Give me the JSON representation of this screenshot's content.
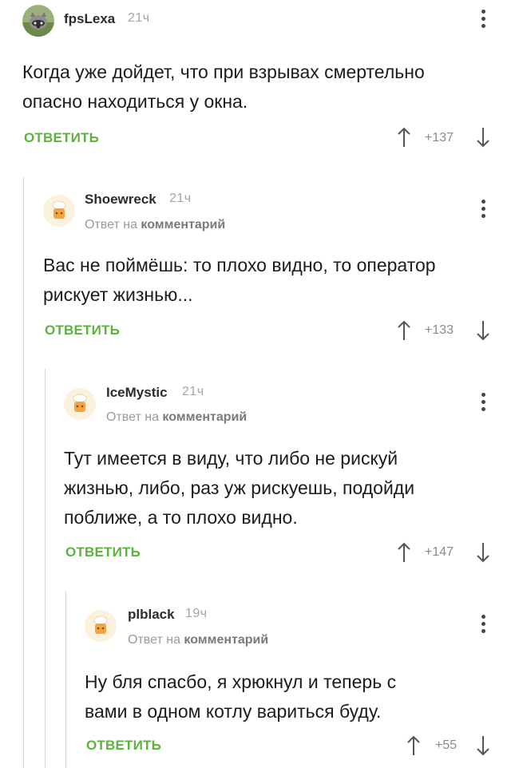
{
  "comments": [
    {
      "author": "fpsLexa",
      "time": "21ч",
      "reply_meta": "",
      "text_lines": [
        "Когда уже дойдет, что при взрывах смертельно",
        "опасно находиться у окна."
      ],
      "reply_label": "ОТВЕТИТЬ",
      "score": "+137",
      "avatar": "raccoon-avatar"
    },
    {
      "author": "Shoewreck",
      "time": "21ч",
      "reply_meta_prefix": "Ответ на",
      "reply_meta_link": "комментарий",
      "text_lines": [
        "Вас не поймёшь: то плохо видно, то оператор",
        "рискует жизнью..."
      ],
      "reply_label": "ОТВЕТИТЬ",
      "score": "+133",
      "avatar": "default-cook-avatar"
    },
    {
      "author": "IceMystic",
      "time": "21ч",
      "reply_meta_prefix": "Ответ на",
      "reply_meta_link": "комментарий",
      "text_lines": [
        "Тут имеется в виду, что либо не рискуй",
        "жизнью, либо, раз уж рискуешь, подойди",
        "поближе, а то плохо видно."
      ],
      "reply_label": "ОТВЕТИТЬ",
      "score": "+147",
      "avatar": "default-cook-avatar"
    },
    {
      "author": "plblack",
      "time": "19ч",
      "reply_meta_prefix": "Ответ на",
      "reply_meta_link": "комментарий",
      "text_lines": [
        "Ну бля спасбо, я хрюкнул и теперь с",
        "вами в одном котлу вариться буду."
      ],
      "reply_label": "ОТВЕТИТЬ",
      "score": "+55",
      "avatar": "default-cook-avatar"
    }
  ],
  "colors": {
    "accent": "#5ab43c",
    "thread_line": "#d7d7d7",
    "muted": "#a4a4a4"
  },
  "icons": [
    "upvote-arrow-icon",
    "downvote-arrow-icon",
    "more-vertical-icon"
  ]
}
